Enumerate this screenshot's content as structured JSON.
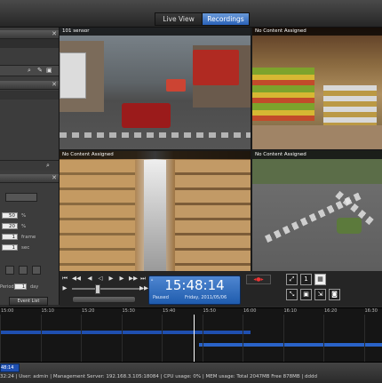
{
  "header": {
    "tab_live": "Live View",
    "tab_recordings": "Recordings"
  },
  "sidebar": {
    "spinners": [
      {
        "value": "50",
        "unit": "%"
      },
      {
        "value": "20",
        "unit": "%"
      },
      {
        "value": "1",
        "unit": "frame"
      },
      {
        "value": "1",
        "unit": "sec"
      }
    ],
    "period_label": "Period",
    "period_value": "1",
    "period_unit": "day",
    "event_list_button": "Event List"
  },
  "cameras": [
    {
      "label": "101 sensor"
    },
    {
      "label": "No Content Assigned"
    },
    {
      "label": "No Content Assigned"
    },
    {
      "label": "No Content Assigned"
    }
  ],
  "playback": {
    "time": "15:48:14",
    "status": "Paused",
    "date": "Friday, 2011/05/06",
    "zoom_label": "1"
  },
  "timeline": {
    "ticks": [
      "15:00",
      "15:10",
      "15:20",
      "15:30",
      "15:40",
      "15:50",
      "16:00",
      "16:10",
      "16:20",
      "16:30"
    ],
    "cursor_time": "15:48:14",
    "footer_time": "48:14"
  },
  "status_bar": {
    "text": "32:24  |  User: admin  |  Management Server: 192.168.3.105:18084  |  CPU usage: 0%  |  MEM usage: Total 2047MB  Free 878MB  |  dddd"
  },
  "colors": {
    "accent": "#2a62b8",
    "record_bar": "#1f4fb0",
    "cursor": "#ffffff"
  }
}
